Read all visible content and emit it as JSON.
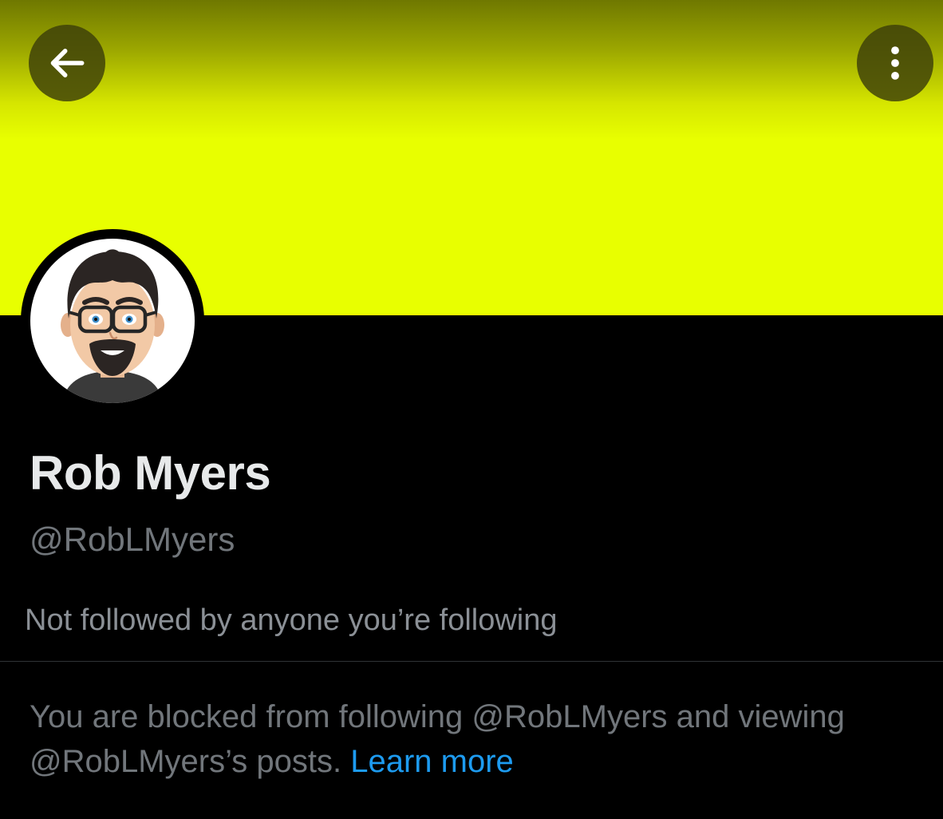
{
  "header": {
    "back_icon": "arrow-left-icon",
    "more_icon": "more-vertical-icon",
    "banner_color": "#e8ff00"
  },
  "profile": {
    "display_name": "Rob Myers",
    "handle": "@RobLMyers",
    "avatar": "cartoon-avatar",
    "followed_by_text": "Not followed by anyone you’re following"
  },
  "blocked": {
    "message_line1": "You are blocked from following @RobLMyers and viewing",
    "message_line2": "@RobLMyers’s posts.",
    "link_label": "Learn more",
    "link_color": "#1d9bf0"
  }
}
